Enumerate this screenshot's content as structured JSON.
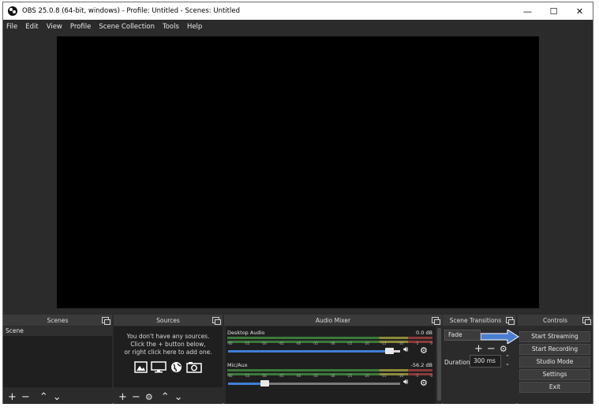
{
  "window": {
    "title": "OBS 25.0.8 (64-bit, windows) - Profile: Untitled - Scenes: Untitled",
    "minimize": "—",
    "maximize": "☐",
    "close": "✕"
  },
  "menu": [
    "File",
    "Edit",
    "View",
    "Profile",
    "Scene Collection",
    "Tools",
    "Help"
  ],
  "docks": {
    "scenes": {
      "title": "Scenes",
      "items": [
        "Scene"
      ]
    },
    "sources": {
      "title": "Sources",
      "empty_lines": [
        "You don't have any sources.",
        "Click the + button below,",
        "or right click here to add one."
      ]
    },
    "mixer": {
      "title": "Audio Mixer",
      "ticks": [
        "-60",
        "-55",
        "-50",
        "-45",
        "-40",
        "-35",
        "-30",
        "-25",
        "-20",
        "-15",
        "-10",
        "-5",
        "0"
      ],
      "channels": [
        {
          "name": "Desktop Audio",
          "db": "0.0 dB",
          "volume": 0.96
        },
        {
          "name": "Mic/Aux",
          "db": "-56.2 dB",
          "volume": 0.2
        }
      ]
    },
    "transitions": {
      "title": "Scene Transitions",
      "selected": "Fade",
      "duration_label": "Duration",
      "duration_value": "300 ms"
    },
    "controls": {
      "title": "Controls",
      "buttons": [
        "Start Streaming",
        "Start Recording",
        "Studio Mode",
        "Settings",
        "Exit"
      ]
    }
  },
  "colors": {
    "arrow": "#4a7fd0",
    "panel": "#2b2b2b",
    "list": "#1f1f1f",
    "fader": "#3f7fd6"
  }
}
